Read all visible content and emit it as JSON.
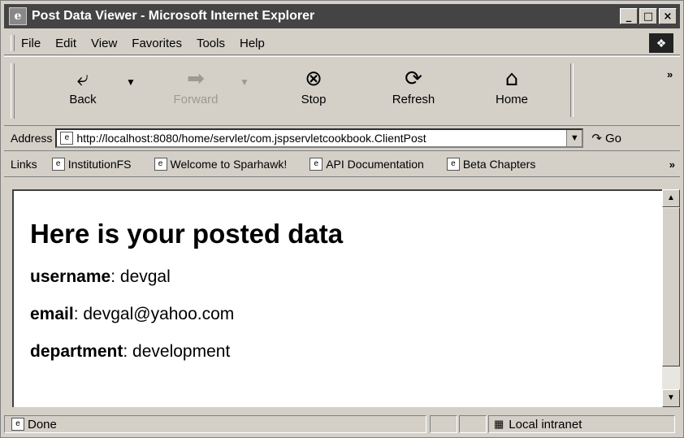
{
  "window": {
    "title": "Post Data Viewer - Microsoft Internet Explorer",
    "min_glyph": "_",
    "max_glyph": "□",
    "close_glyph": "×"
  },
  "menu": {
    "items": [
      "File",
      "Edit",
      "View",
      "Favorites",
      "Tools",
      "Help"
    ]
  },
  "toolbar": {
    "back_label": "Back",
    "forward_label": "Forward",
    "stop_label": "Stop",
    "refresh_label": "Refresh",
    "home_label": "Home",
    "more_glyph": "»"
  },
  "address": {
    "label": "Address",
    "url": "http://localhost:8080/home/servlet/com.jspservletcookbook.ClientPost",
    "go_label": "Go"
  },
  "links": {
    "label": "Links",
    "items": [
      "InstitutionFS",
      "Welcome to Sparhawk!",
      "API Documentation",
      "Beta Chapters"
    ],
    "more_glyph": "»"
  },
  "page": {
    "heading": "Here is your posted data",
    "fields": [
      {
        "name": "username",
        "value": ": devgal"
      },
      {
        "name": "email",
        "value": ": devgal@yahoo.com"
      },
      {
        "name": "department",
        "value": ": development"
      }
    ]
  },
  "status": {
    "text": "Done",
    "zone": "Local intranet"
  }
}
